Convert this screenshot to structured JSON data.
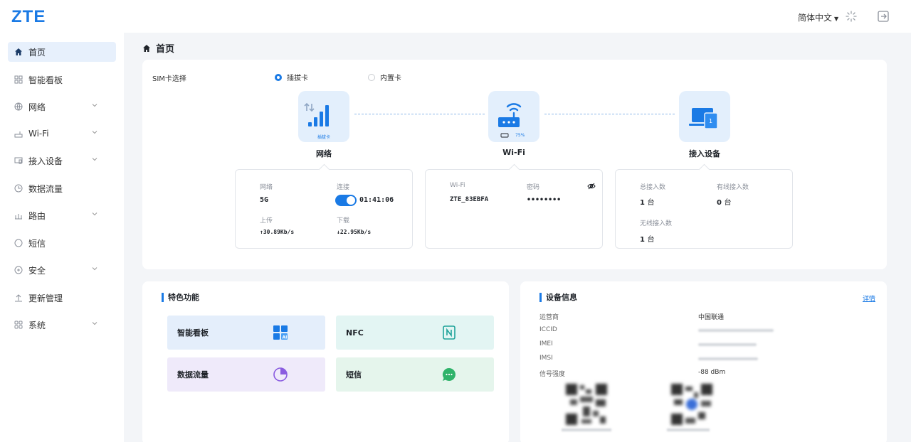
{
  "header": {
    "logo": "ZTE",
    "language": "简体中文",
    "icons": [
      "loading-spinner-icon",
      "logout-icon"
    ]
  },
  "sidebar": {
    "items": [
      {
        "label": "首页",
        "icon": "home-icon",
        "active": true,
        "expandable": false
      },
      {
        "label": "智能看板",
        "icon": "dashboard-icon",
        "active": false,
        "expandable": false
      },
      {
        "label": "网络",
        "icon": "globe-icon",
        "active": false,
        "expandable": true
      },
      {
        "label": "Wi-Fi",
        "icon": "router-icon",
        "active": false,
        "expandable": true
      },
      {
        "label": "接入设备",
        "icon": "devices-icon",
        "active": false,
        "expandable": true
      },
      {
        "label": "数据流量",
        "icon": "clock-icon",
        "active": false,
        "expandable": false
      },
      {
        "label": "路由",
        "icon": "route-icon",
        "active": false,
        "expandable": true
      },
      {
        "label": "短信",
        "icon": "message-icon",
        "active": false,
        "expandable": false
      },
      {
        "label": "安全",
        "icon": "shield-icon",
        "active": false,
        "expandable": true
      },
      {
        "label": "更新管理",
        "icon": "upload-icon",
        "active": false,
        "expandable": false
      },
      {
        "label": "系统",
        "icon": "grid-icon",
        "active": false,
        "expandable": true
      }
    ]
  },
  "main": {
    "title": "首页",
    "sim": {
      "label": "SIM卡选择",
      "options": [
        {
          "label": "插拔卡",
          "selected": true
        },
        {
          "label": "内置卡",
          "selected": false
        }
      ]
    },
    "topology": {
      "network": {
        "caption": "网络",
        "tile_sub": "插拔卡"
      },
      "wifi": {
        "caption": "Wi-Fi",
        "battery": "75%"
      },
      "devices": {
        "caption": "接入设备",
        "badge": "1"
      }
    },
    "network_box": {
      "network_label": "网络",
      "network_value": "5G",
      "connect_label": "连接",
      "connect_value": "01:41:06",
      "connected": true,
      "upload_label": "上传",
      "upload_value": "30.89Kb/s",
      "download_label": "下载",
      "download_value": "22.95Kb/s"
    },
    "wifi_box": {
      "ssid_label": "Wi-Fi",
      "ssid_value": "ZTE_83EBFA",
      "password_label": "密码",
      "password_value": "••••••••"
    },
    "devices_box": {
      "total_label": "总接入数",
      "total_value": "1",
      "wired_label": "有线接入数",
      "wired_value": "0",
      "wireless_label": "无线接入数",
      "wireless_value": "1",
      "unit": "台"
    },
    "features": {
      "title": "特色功能",
      "items": [
        {
          "label": "智能看板",
          "icon": "dashboard-ai-icon",
          "bg": "#e4eefb"
        },
        {
          "label": "NFC",
          "icon": "nfc-icon",
          "bg": "#e3f5f3"
        },
        {
          "label": "数据流量",
          "icon": "pie-chart-icon",
          "bg": "#efeafa"
        },
        {
          "label": "短信",
          "icon": "chat-bubble-icon",
          "bg": "#e5f5ec"
        }
      ]
    },
    "device_info": {
      "title": "设备信息",
      "detail_link": "详情",
      "rows": [
        {
          "label": "运营商",
          "value": "中国联通"
        },
        {
          "label": "ICCID",
          "value": ""
        },
        {
          "label": "IMEI",
          "value": ""
        },
        {
          "label": "IMSI",
          "value": ""
        },
        {
          "label": "信号强度",
          "value": "-88 dBm"
        }
      ]
    }
  },
  "colors": {
    "accent": "#1a7ae5",
    "active_nav_bg": "#e7f0fc",
    "page_bg": "#f3f5f8"
  }
}
